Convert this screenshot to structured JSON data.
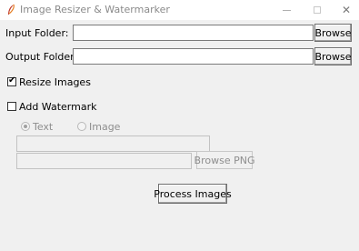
{
  "window": {
    "title": "Image Resizer & Watermarker",
    "icon": "feather-icon",
    "controls": {
      "minimize": "minimize-icon",
      "maximize": "maximize-icon",
      "close": "close-icon",
      "close_glyph": "✕"
    }
  },
  "input_folder": {
    "label": "Input Folder:",
    "value": "",
    "browse_label": "Browse"
  },
  "output_folder": {
    "label": "Output Folder:",
    "value": "",
    "browse_label": "Browse"
  },
  "resize": {
    "label": "Resize Images",
    "checked": true,
    "check_glyph": "✔"
  },
  "watermark": {
    "label": "Add Watermark",
    "checked": false,
    "type_options": [
      {
        "label": "Text",
        "selected": true
      },
      {
        "label": "Image",
        "selected": false
      }
    ],
    "text_value": "",
    "image_path": "",
    "browse_png_label": "Browse PNG"
  },
  "process_label": "Process Images",
  "colors": {
    "window_bg": "#f0f0f0",
    "titlebar_bg": "#ffffff",
    "disabled_text": "#8e8e8e"
  }
}
